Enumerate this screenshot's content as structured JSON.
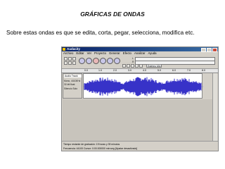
{
  "slide": {
    "title": "GRÁFICAS DE ONDAS",
    "body": "Sobre estas ondas es que se edita, corta, pegar, selecciona, modifica etc."
  },
  "editor": {
    "window_title": "Audacity",
    "menu": [
      "Archivo",
      "Editar",
      "Ver",
      "Proyecto",
      "Generar",
      "Efecto",
      "Analizar",
      "Ayuda"
    ],
    "toolbar": {
      "device_label": "Estéreo Mix",
      "meter_left_label": "L",
      "meter_right_label": "R"
    },
    "ruler_ticks": [
      "0.0",
      "1.0",
      "2.0",
      "3.0",
      "4.0",
      "5.0",
      "6.0",
      "7.0",
      "8.0"
    ],
    "track": {
      "name": "Audio Track",
      "lines": [
        "Mono, 44100Hz",
        "32-bit float",
        "Silencio  Solo"
      ]
    },
    "status": {
      "line1": "Tiempo restante de grabación: 19 horas y 39 minutos",
      "line2": "Frecuencia: 44100   Cursor: 0:00.000000 min:seg  [Ajustar desactivado]"
    },
    "colors": {
      "titlebar": "#0a246a",
      "waveform": "#3732c8",
      "panel": "#d4d0c8"
    }
  }
}
